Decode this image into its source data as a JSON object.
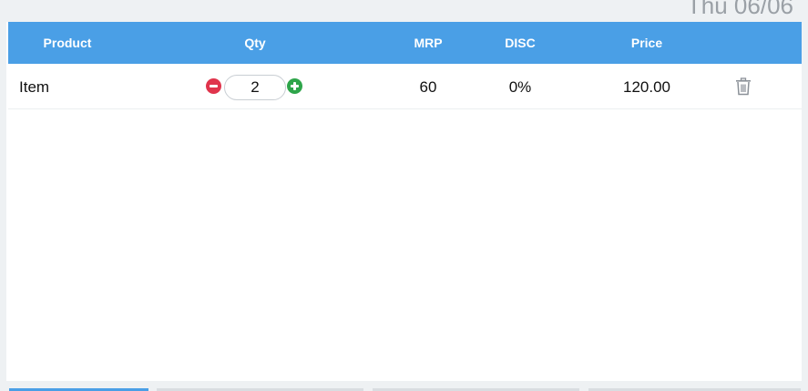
{
  "header": {
    "date_text": "Thu 06/06"
  },
  "table": {
    "columns": [
      "Product",
      "Qty",
      "MRP",
      "DISC",
      "Price"
    ],
    "rows": [
      {
        "product": "Item",
        "qty": "2",
        "mrp": "60",
        "disc": "0%",
        "price": "120.00"
      }
    ]
  },
  "colors": {
    "header_bg": "#4a9fe6",
    "minus": "#e0344c",
    "plus": "#2ea54a",
    "page_bg": "#eef1f3"
  },
  "icons": {
    "minus": "minus-circle-icon",
    "plus": "plus-circle-icon",
    "delete": "trash-icon"
  }
}
